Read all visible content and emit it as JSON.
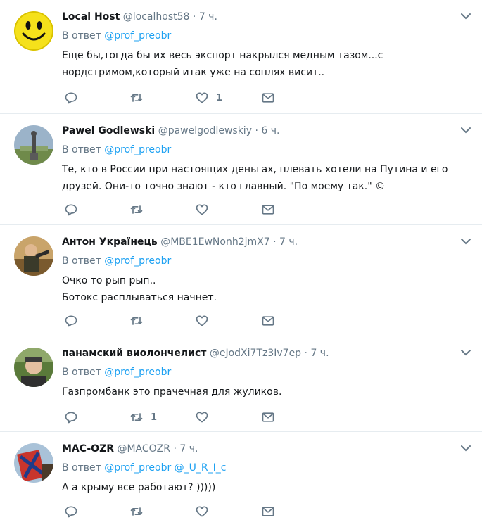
{
  "tweets": [
    {
      "name": "Local Host",
      "handle": "@localhost58",
      "dot": "·",
      "time": "7 ч.",
      "reply_prefix": "В ответ",
      "mentions": "@prof_preobr",
      "lines": [
        "Еще бы,тогда бы их весь экспорт накрылся медным тазом...с",
        "нордстримом,который итак уже на соплях висит.."
      ],
      "retweets": "",
      "likes": "1"
    },
    {
      "name": "Pawel Godlewski",
      "handle": "@pawelgodlewskiy",
      "dot": "·",
      "time": "6 ч.",
      "reply_prefix": "В ответ",
      "mentions": "@prof_preobr",
      "lines": [
        "Те, кто в России при настоящих деньгах, плевать хотели на Путина и его",
        "друзей. Они-то точно знают - кто главный. \"По моему так.\" ©"
      ],
      "retweets": "",
      "likes": ""
    },
    {
      "name": "Антон Українець",
      "handle": "@MBE1EwNonh2jmX7",
      "dot": "·",
      "time": "7 ч.",
      "reply_prefix": "В ответ",
      "mentions": "@prof_preobr",
      "lines": [
        "Очко то рып рып..",
        "Ботокс расплываться начнет."
      ],
      "retweets": "",
      "likes": ""
    },
    {
      "name": "панамский виолончелист",
      "handle": "@eJodXi7Tz3Iv7ep",
      "dot": "·",
      "time": "7 ч.",
      "reply_prefix": "В ответ",
      "mentions": "@prof_preobr",
      "lines": [
        "Газпромбанк это прачечная для жуликов."
      ],
      "retweets": "1",
      "likes": ""
    },
    {
      "name": "MAC-OZR",
      "handle": "@MACOZR",
      "dot": "·",
      "time": "7 ч.",
      "reply_prefix": "В ответ",
      "mentions": "@prof_preobr @_U_R_I_c",
      "lines": [
        "А а крыму все работают? )))))"
      ],
      "retweets": "",
      "likes": ""
    }
  ],
  "colors": {
    "link": "#1da1f2",
    "secondary": "#657786",
    "divider": "#e6ecf0"
  },
  "icons": [
    "smiley-avatar",
    "chevron-down-icon",
    "reply-icon",
    "retweet-icon",
    "like-icon",
    "message-icon"
  ]
}
